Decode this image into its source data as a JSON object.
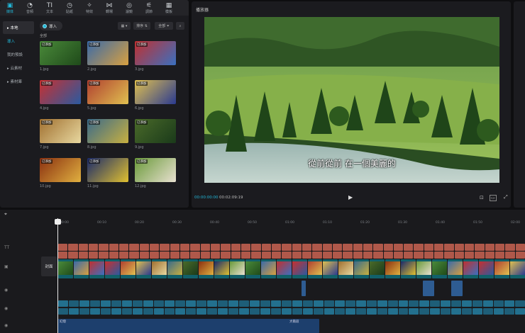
{
  "tabs": [
    {
      "icon": "▣",
      "label": "媒体"
    },
    {
      "icon": "◔",
      "label": "音頻"
    },
    {
      "icon": "TI",
      "label": "文本"
    },
    {
      "icon": "◷",
      "label": "貼紙"
    },
    {
      "icon": "✧",
      "label": "特效"
    },
    {
      "icon": "⋈",
      "label": "轉場"
    },
    {
      "icon": "◎",
      "label": "濾鏡"
    },
    {
      "icon": "⚟",
      "label": "調節"
    },
    {
      "icon": "▦",
      "label": "模板"
    }
  ],
  "sidebar": {
    "items": [
      "▸ 本地",
      "導入",
      "我的預設",
      "▸ 云素材",
      "▸ 素材庫"
    ]
  },
  "media": {
    "import_label": "導入",
    "all_label": "全部",
    "sort_label": "排序",
    "filter_label": "全部",
    "added_tag": "已添加",
    "files": [
      "1.jpg",
      "2.jpg",
      "3.jpg",
      "4.jpg",
      "5.jpg",
      "6.jpg",
      "7.jpg",
      "8.jpg",
      "9.jpg",
      "10.jpg",
      "11.jpg",
      "12.jpg"
    ]
  },
  "player": {
    "title": "播放器",
    "subtitle": "從前從前 在一個美麗的",
    "time_current": "00:00:00:00",
    "time_total": "00:02:09:19"
  },
  "timeline": {
    "ticks": [
      "00:00",
      "00:10",
      "00:20",
      "00:30",
      "00:40",
      "00:50",
      "01:00",
      "01:10",
      "01:20",
      "01:30",
      "01:40",
      "01:50",
      "02:00"
    ],
    "cover_label": "封面",
    "bgm_start": "幻燈",
    "bgm_end": "大衛段"
  },
  "colors": {
    "accent": "#22b7d8",
    "text_clip": "#b0584a",
    "video_clip": "#11606a",
    "audio_clip": "#1e5e78"
  }
}
